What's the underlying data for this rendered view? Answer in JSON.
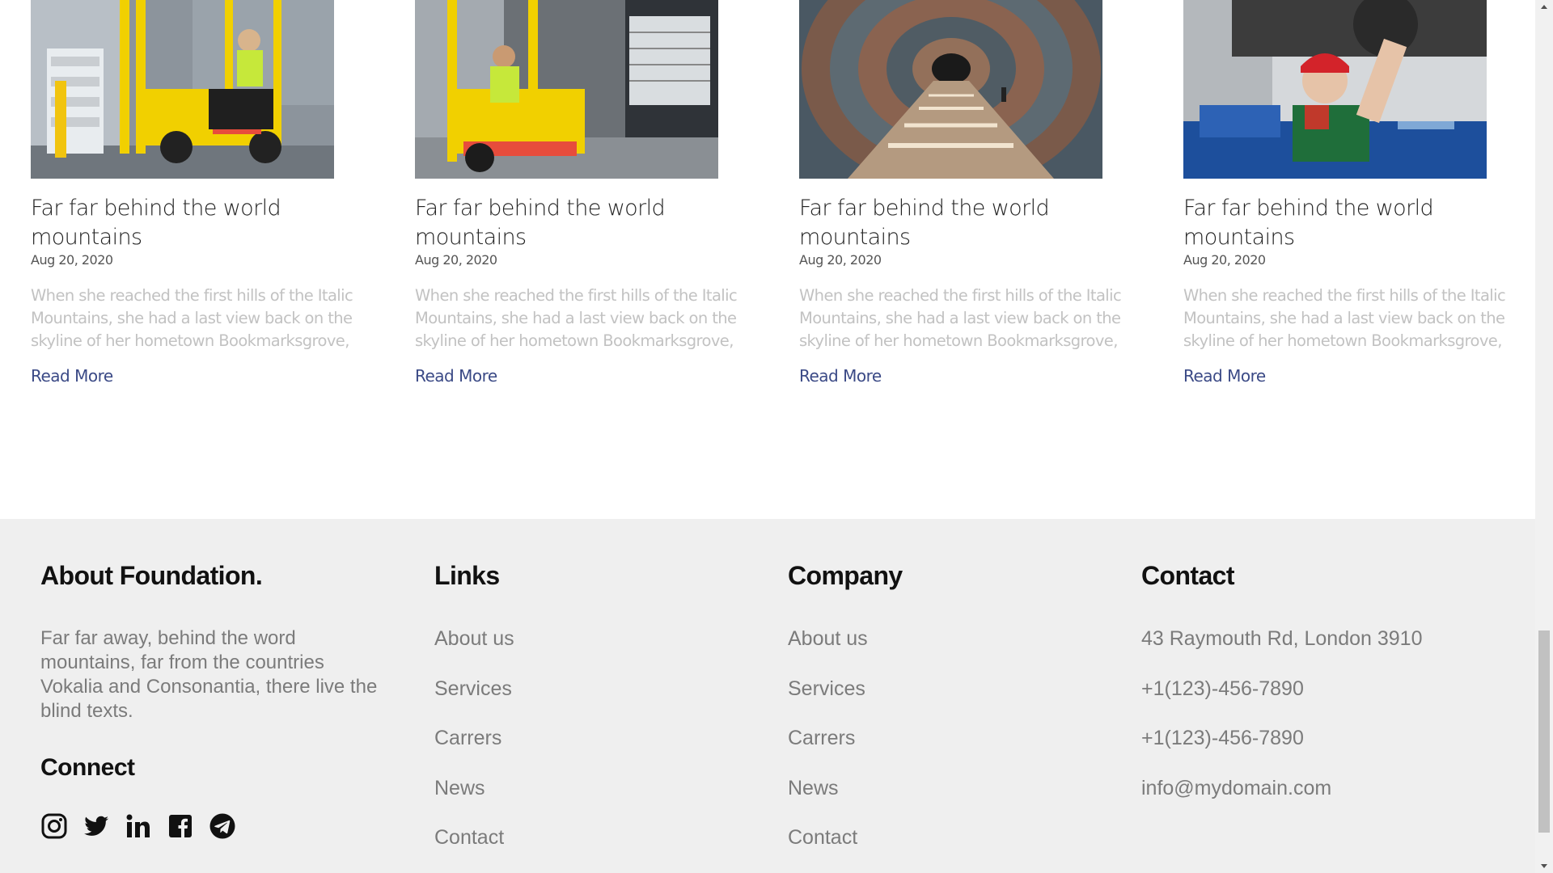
{
  "cards": [
    {
      "image_alt": "Forklift operator in warehouse",
      "title": "Far far behind the world mountains",
      "date": "Aug 20, 2020",
      "excerpt": "When she reached the first hills of the Italic Mountains, she had a last view back on the skyline of her hometown Bookmarksgrove,",
      "link": "Read More"
    },
    {
      "image_alt": "Worker driving a yellow forklift",
      "title": "Far far behind the world mountains",
      "date": "Aug 20, 2020",
      "excerpt": "When she reached the first hills of the Italic Mountains, she had a last view back on the skyline of her hometown Bookmarksgrove,",
      "link": "Read More"
    },
    {
      "image_alt": "Arched glass tunnel walkway",
      "title": "Far far behind the world mountains",
      "date": "Aug 20, 2020",
      "excerpt": "When she reached the first hills of the Italic Mountains, she had a last view back on the skyline of her hometown Bookmarksgrove,",
      "link": "Read More"
    },
    {
      "image_alt": "Mechanic working under a car",
      "title": "Far far behind the world mountains",
      "date": "Aug 20, 2020",
      "excerpt": "When she reached the first hills of the Italic Mountains, she had a last view back on the skyline of her hometown Bookmarksgrove,",
      "link": "Read More"
    }
  ],
  "footer": {
    "about": {
      "heading": "About Foundation.",
      "text": "Far far away, behind the word mountains, far from the countries Vokalia and Consonantia, there live the blind texts.",
      "connect": "Connect",
      "socials": [
        "instagram-icon",
        "twitter-icon",
        "linkedin-icon",
        "facebook-icon",
        "telegram-icon"
      ]
    },
    "links": {
      "heading": "Links",
      "items": [
        "About us",
        "Services",
        "Carrers",
        "News",
        "Contact"
      ]
    },
    "company": {
      "heading": "Company",
      "items": [
        "About us",
        "Services",
        "Carrers",
        "News",
        "Contact"
      ]
    },
    "contact": {
      "heading": "Contact",
      "address": "43 Raymouth Rd, London 3910",
      "phone1": "+1(123)-456-7890",
      "phone2": "+1(123)-456-7890",
      "email": "info@mydomain.com"
    }
  },
  "colors": {
    "link_blue": "#3b4a86",
    "footer_bg": "#efefef",
    "muted_text": "#7b7b7b",
    "excerpt_text": "#c2c2c2"
  }
}
